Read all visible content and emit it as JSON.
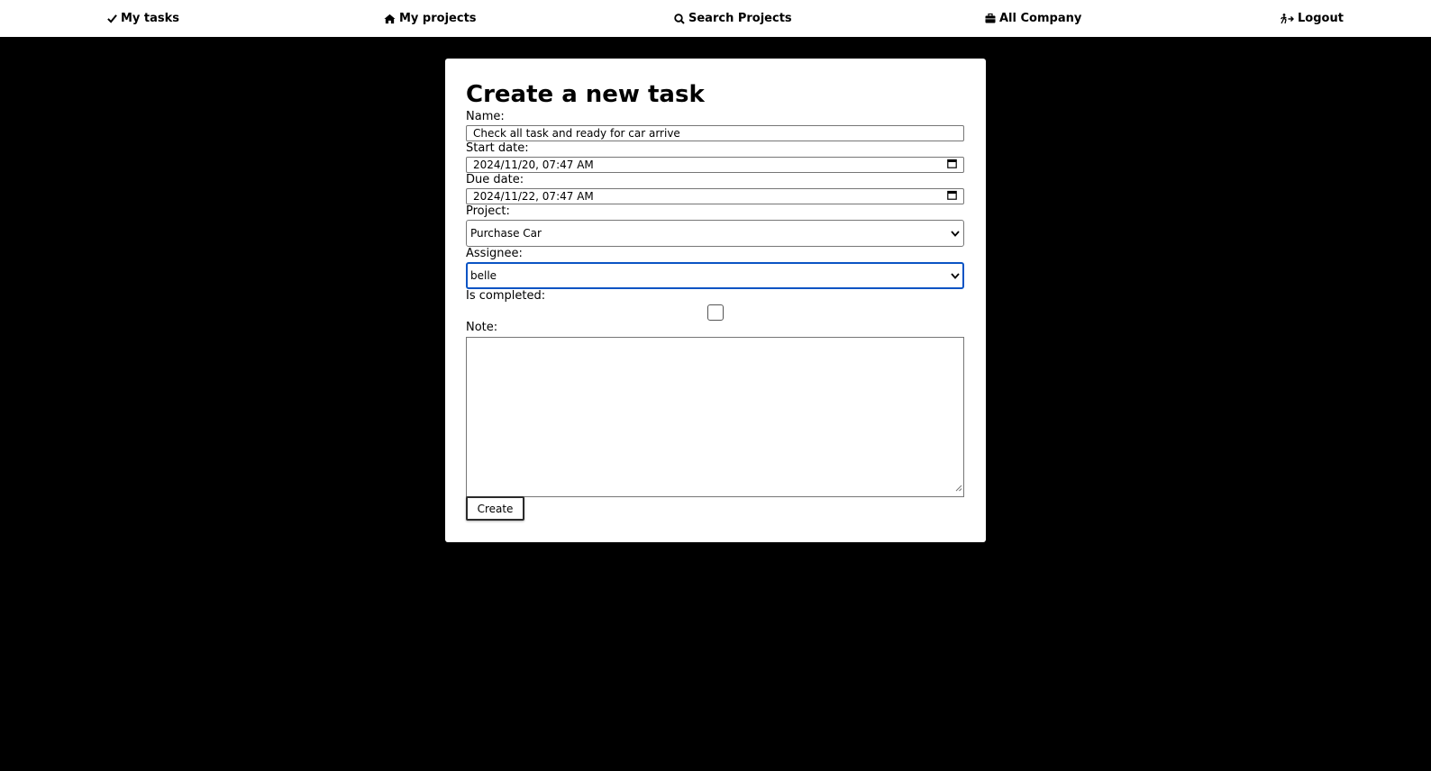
{
  "nav": {
    "my_tasks": {
      "label": "My tasks",
      "icon": "check-icon"
    },
    "my_projects": {
      "label": "My projects",
      "icon": "home-icon"
    },
    "search_projects": {
      "label": "Search Projects",
      "icon": "search-icon"
    },
    "all_company": {
      "label": "All Company",
      "icon": "briefcase-icon"
    },
    "logout": {
      "label": "Logout",
      "icon": "logout-icon"
    }
  },
  "form": {
    "title": "Create a new task",
    "name_label": "Name:",
    "name_value": "Check all task and ready for car arrive",
    "start_label": "Start date:",
    "start_value": "2024/11/20, 07:47  AM",
    "due_label": "Due date:",
    "due_value": "2024/11/22, 07:47  AM",
    "project_label": "Project:",
    "project_value": "Purchase Car",
    "assignee_label": "Assignee:",
    "assignee_value": "belle",
    "completed_label": "Is completed:",
    "completed_checked": false,
    "note_label": "Note:",
    "note_value": "",
    "submit_label": "Create"
  },
  "colors": {
    "background": "#000000",
    "card": "#ffffff",
    "focus_border": "#0a54c4"
  }
}
